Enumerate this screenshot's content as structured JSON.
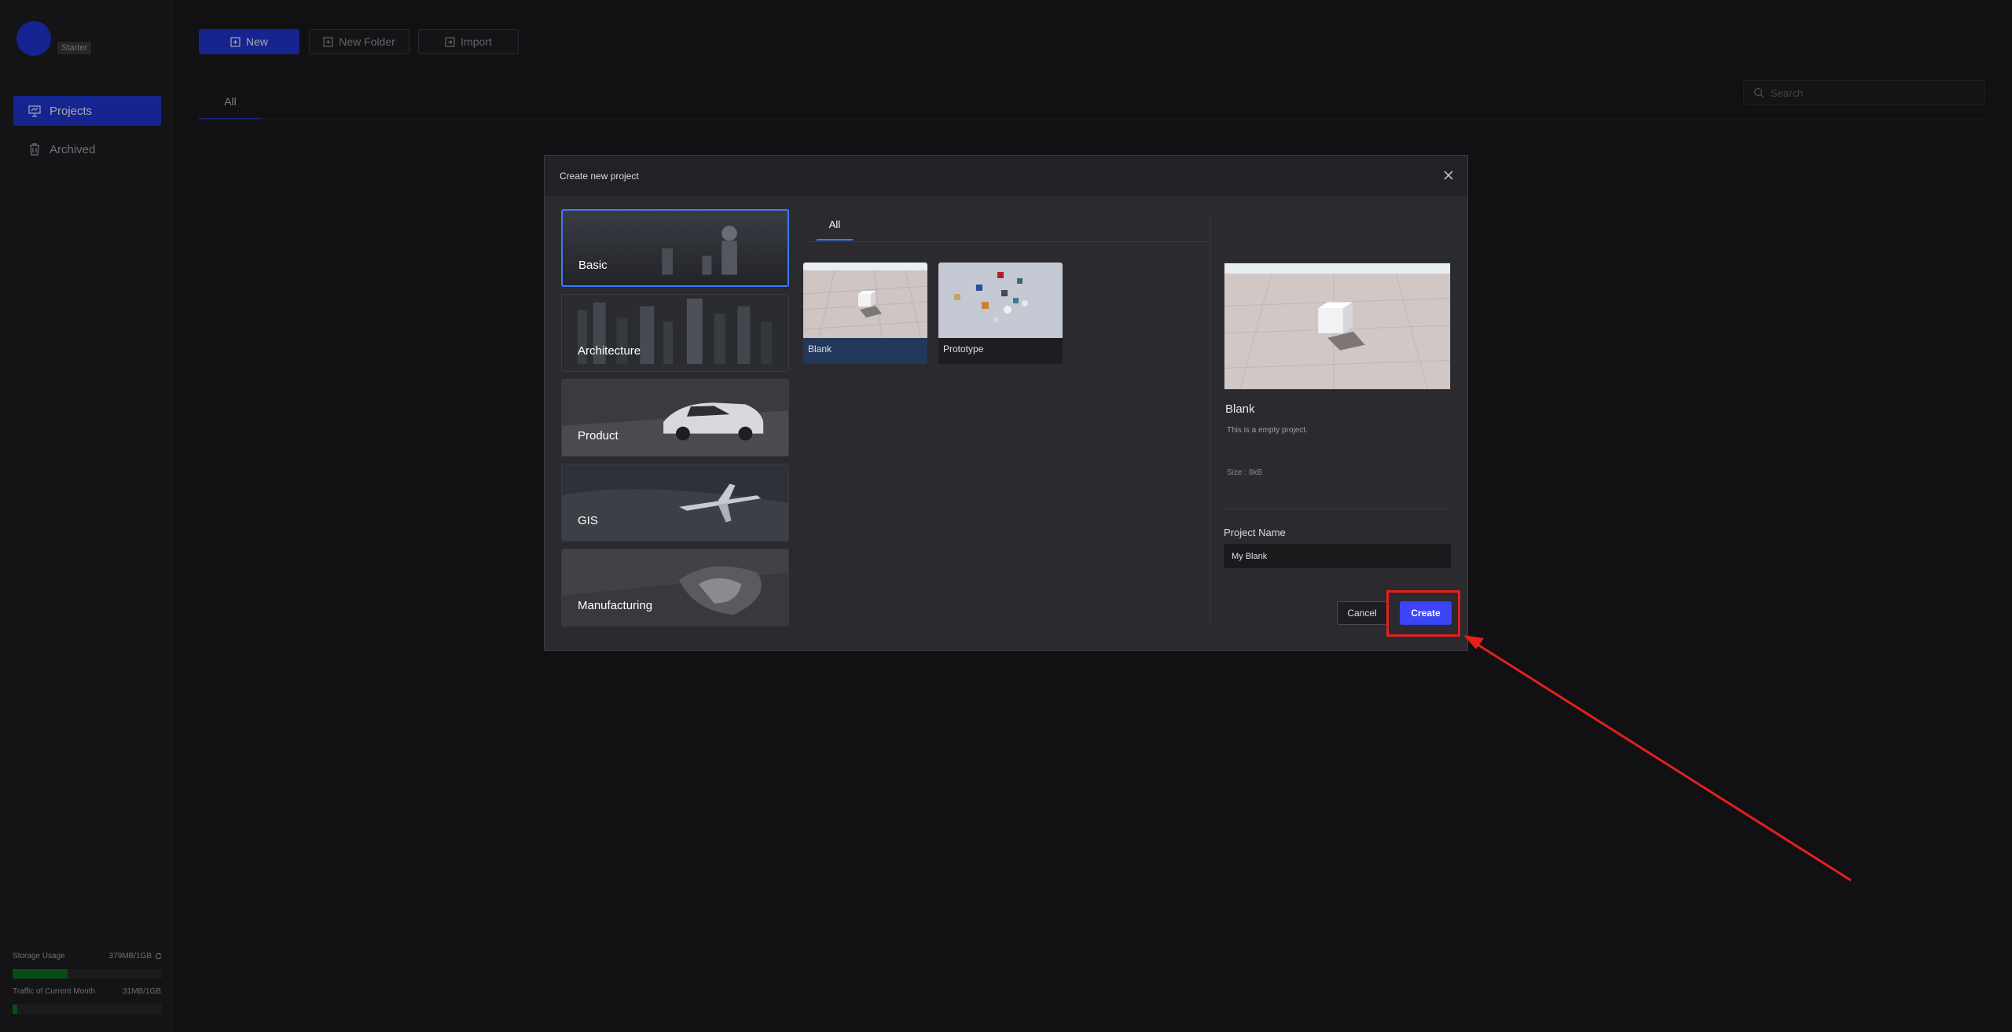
{
  "sidebar": {
    "plan": "Starter",
    "items": [
      {
        "label": "Projects"
      },
      {
        "label": "Archived"
      }
    ],
    "storage": {
      "label": "Storage Usage",
      "value": "379MB/1GB",
      "fraction": 0.37
    },
    "traffic": {
      "label": "Traffic of Current Month",
      "value": "31MB/1GB",
      "fraction": 0.03
    }
  },
  "toolbar": {
    "new_label": "New",
    "folder_label": "New Folder",
    "import_label": "Import"
  },
  "tabs": {
    "all": "All"
  },
  "search": {
    "placeholder": "Search"
  },
  "dialog": {
    "title": "Create new project",
    "categories": [
      {
        "label": "Basic"
      },
      {
        "label": "Architecture"
      },
      {
        "label": "Product"
      },
      {
        "label": "GIS"
      },
      {
        "label": "Manufacturing"
      }
    ],
    "sub_tab": "All",
    "templates": [
      {
        "label": "Blank"
      },
      {
        "label": "Prototype"
      }
    ],
    "preview": {
      "title": "Blank",
      "description": "This is a empty project.",
      "size": "Size :  8kB"
    },
    "project_name_label": "Project Name",
    "project_name_value": "My Blank",
    "cancel_label": "Cancel",
    "create_label": "Create"
  },
  "colors": {
    "accent": "#1f33c7",
    "create": "#3b44f6",
    "annotation": "#e5201c",
    "storage_bar": "#0d6b1c"
  }
}
